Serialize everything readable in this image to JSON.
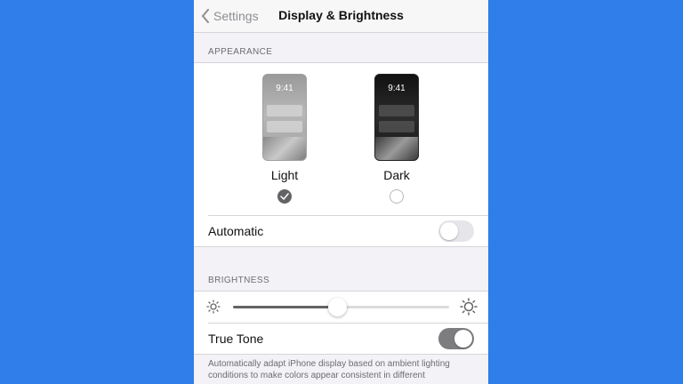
{
  "navbar": {
    "back_label": "Settings",
    "title": "Display & Brightness"
  },
  "appearance": {
    "header": "APPEARANCE",
    "options": [
      {
        "label": "Light",
        "time": "9:41",
        "selected": true
      },
      {
        "label": "Dark",
        "time": "9:41",
        "selected": false
      }
    ],
    "automatic_label": "Automatic",
    "automatic_on": false
  },
  "brightness": {
    "header": "BRIGHTNESS",
    "level": 0.48,
    "true_tone_label": "True Tone",
    "true_tone_on": true,
    "footnote": "Automatically adapt iPhone display based on ambient lighting conditions to make colors appear consistent in different"
  },
  "icons": {
    "back": "chevron-left-icon",
    "brightness_low": "sun-small-icon",
    "brightness_high": "sun-large-icon",
    "check": "checkmark-icon"
  },
  "colors": {
    "background": "#2f7ee9",
    "selected_radio": "#636366",
    "toggle_on": "#7d7d80"
  }
}
